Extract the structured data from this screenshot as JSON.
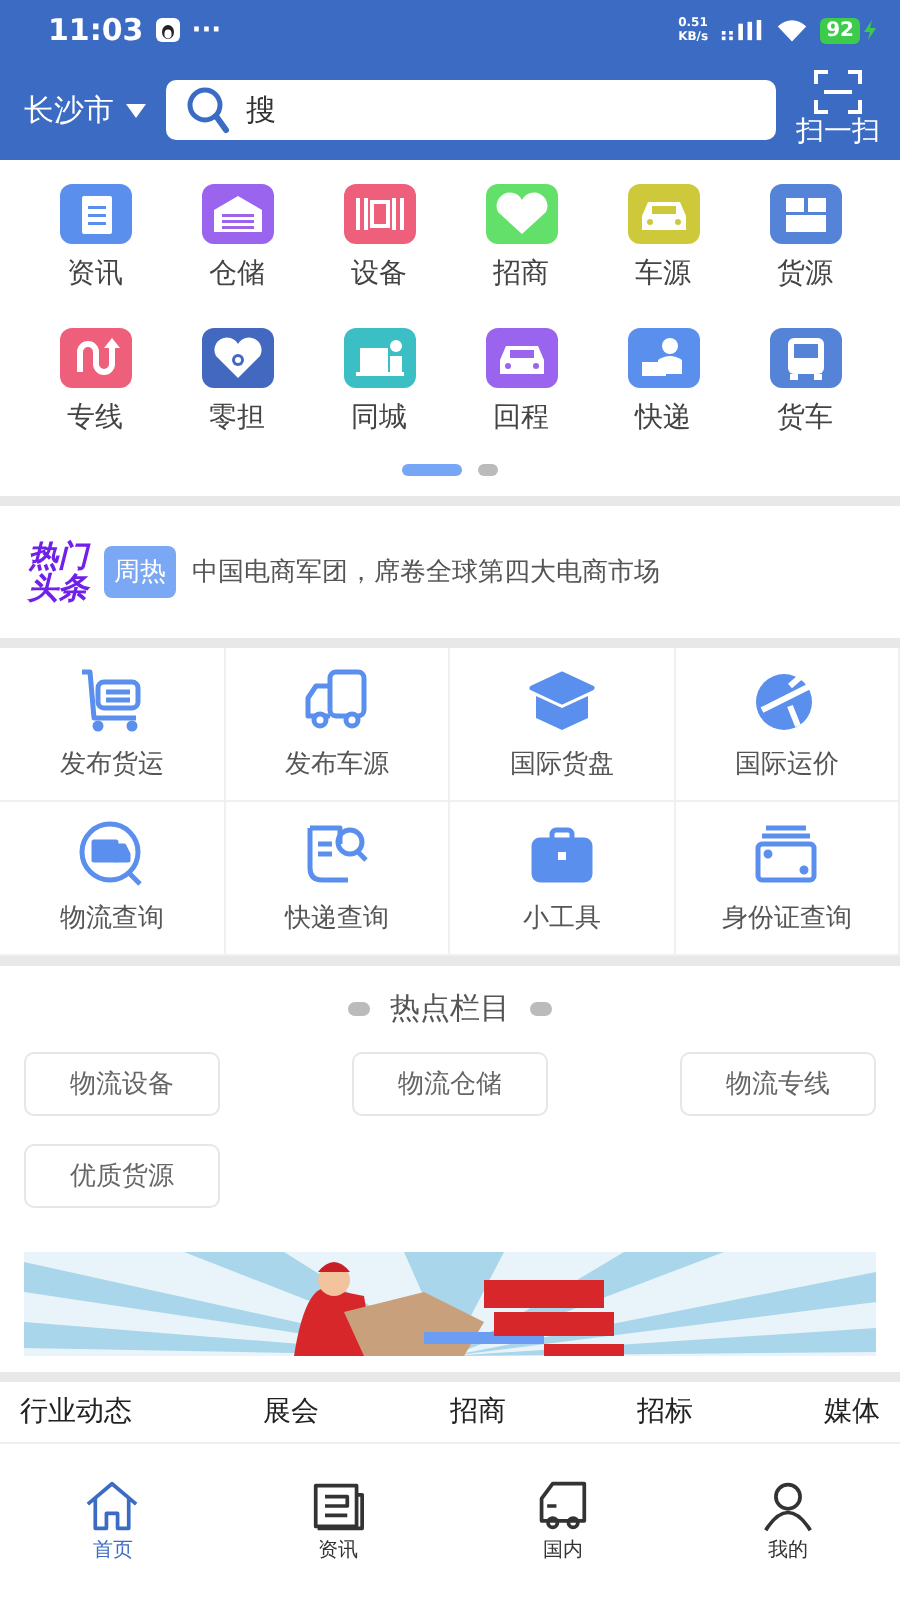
{
  "status_bar": {
    "time": "11:03",
    "more": "···",
    "speed_value": "0.51",
    "speed_unit": "KB/s",
    "battery": "92"
  },
  "header": {
    "city": "长沙市",
    "search_placeholder": "搜",
    "scan_label": "扫一扫"
  },
  "grid": [
    {
      "label": "资讯",
      "color": "#5b8fee"
    },
    {
      "label": "仓储",
      "color": "#9b64ee"
    },
    {
      "label": "设备",
      "color": "#ee5f7c"
    },
    {
      "label": "招商",
      "color": "#63e069"
    },
    {
      "label": "车源",
      "color": "#cdc93a"
    },
    {
      "label": "货源",
      "color": "#5483d8"
    },
    {
      "label": "专线",
      "color": "#ee5f7c"
    },
    {
      "label": "零担",
      "color": "#4269bf"
    },
    {
      "label": "同城",
      "color": "#3cbfc4"
    },
    {
      "label": "回程",
      "color": "#9b64ee"
    },
    {
      "label": "快递",
      "color": "#5b8fee"
    },
    {
      "label": "货车",
      "color": "#5483d8"
    }
  ],
  "pager": [
    {
      "selected": true
    },
    {
      "selected": false
    }
  ],
  "headline": {
    "logo_line1": "热门",
    "logo_line2": "头条",
    "badge": "周热",
    "text": "中国电商军团，席卷全球第四大电商市场"
  },
  "tools": [
    {
      "label": "发布货运"
    },
    {
      "label": "发布车源"
    },
    {
      "label": "国际货盘"
    },
    {
      "label": "国际运价"
    },
    {
      "label": "物流查询"
    },
    {
      "label": "快递查询"
    },
    {
      "label": "小工具"
    },
    {
      "label": "身份证查询"
    }
  ],
  "hot": {
    "title": "热点栏目",
    "chips": [
      "物流设备",
      "物流仓储",
      "物流专线",
      "优质货源"
    ],
    "banner": {
      "kind": "picture"
    }
  },
  "categories": [
    "行业动态",
    "展会",
    "招商",
    "招标",
    "媒体"
  ],
  "bottom_nav": [
    {
      "label": "首页",
      "selected": true
    },
    {
      "label": "资讯",
      "selected": false
    },
    {
      "label": "国内",
      "selected": false
    },
    {
      "label": "我的",
      "selected": false
    }
  ]
}
